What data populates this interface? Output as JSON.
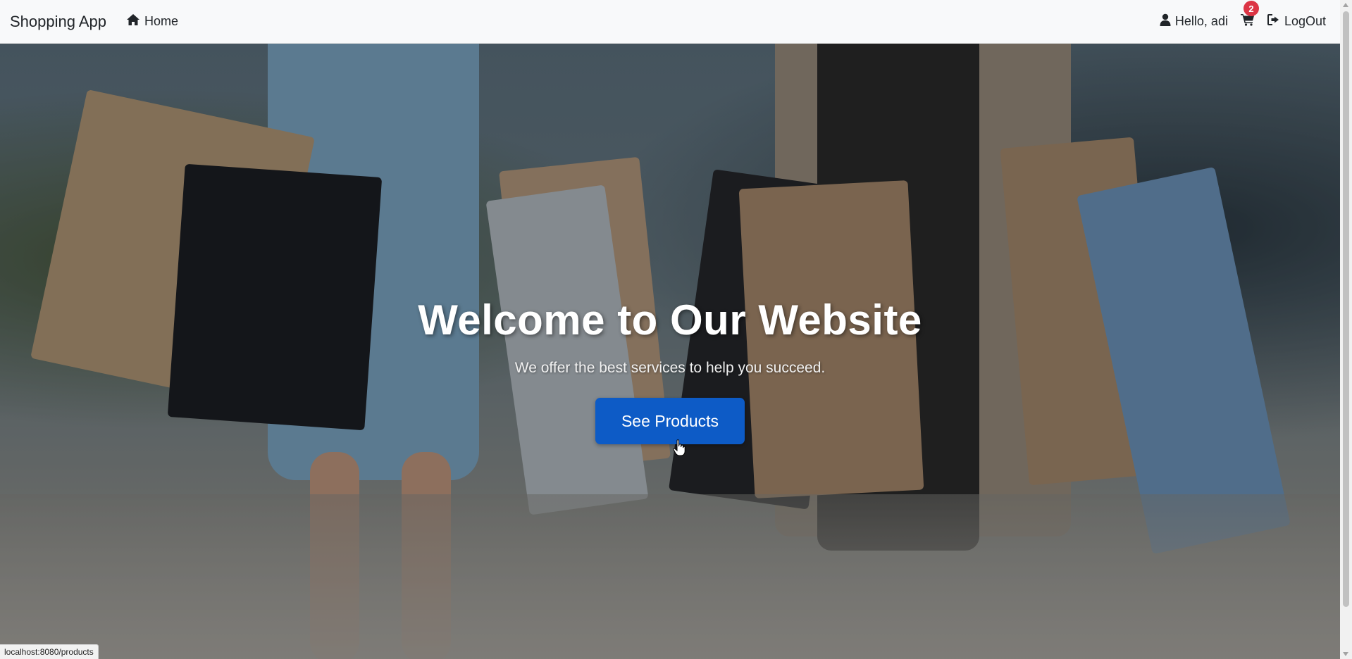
{
  "navbar": {
    "brand": "Shopping App",
    "home_label": "Home",
    "greeting": "Hello, adi",
    "cart_count": "2",
    "logout_label": "LogOut"
  },
  "hero": {
    "title": "Welcome to Our Website",
    "subtitle": "We offer the best services to help you succeed.",
    "cta_label": "See Products"
  },
  "status_bar": {
    "url": "localhost:8080/products"
  },
  "colors": {
    "navbar_bg": "#f8f9fa",
    "button_primary": "#0d5bc6",
    "badge_danger": "#dc3545"
  },
  "icons": {
    "home": "home-icon",
    "user": "user-icon",
    "cart": "cart-icon",
    "logout": "logout-icon"
  }
}
